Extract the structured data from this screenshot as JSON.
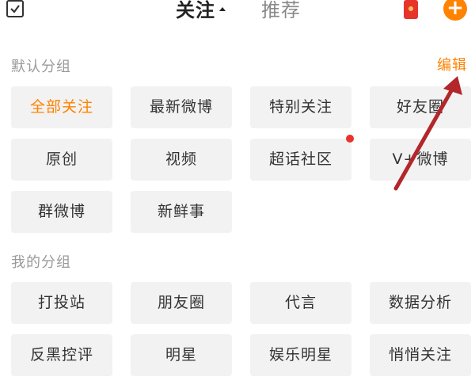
{
  "header": {
    "tabs": [
      {
        "label": "关注"
      },
      {
        "label": "推荐"
      }
    ],
    "plus_label": "+"
  },
  "default_group": {
    "title": "默认分组",
    "edit_label": "编辑",
    "chips": [
      {
        "label": "全部关注"
      },
      {
        "label": "最新微博"
      },
      {
        "label": "特别关注"
      },
      {
        "label": "好友圈"
      },
      {
        "label": "原创"
      },
      {
        "label": "视频"
      },
      {
        "label": "超话社区"
      },
      {
        "label": "V+微博"
      },
      {
        "label": "群微博"
      },
      {
        "label": "新鲜事"
      }
    ]
  },
  "my_group": {
    "title": "我的分组",
    "chips": [
      {
        "label": "打投站"
      },
      {
        "label": "朋友圈"
      },
      {
        "label": "代言"
      },
      {
        "label": "数据分析"
      },
      {
        "label": "反黑控评"
      },
      {
        "label": "明星"
      },
      {
        "label": "娱乐明星"
      },
      {
        "label": "悄悄关注"
      }
    ]
  },
  "colors": {
    "accent": "#ff8200",
    "annotation_arrow": "#b3262a",
    "badge_dot": "#e8332b"
  }
}
